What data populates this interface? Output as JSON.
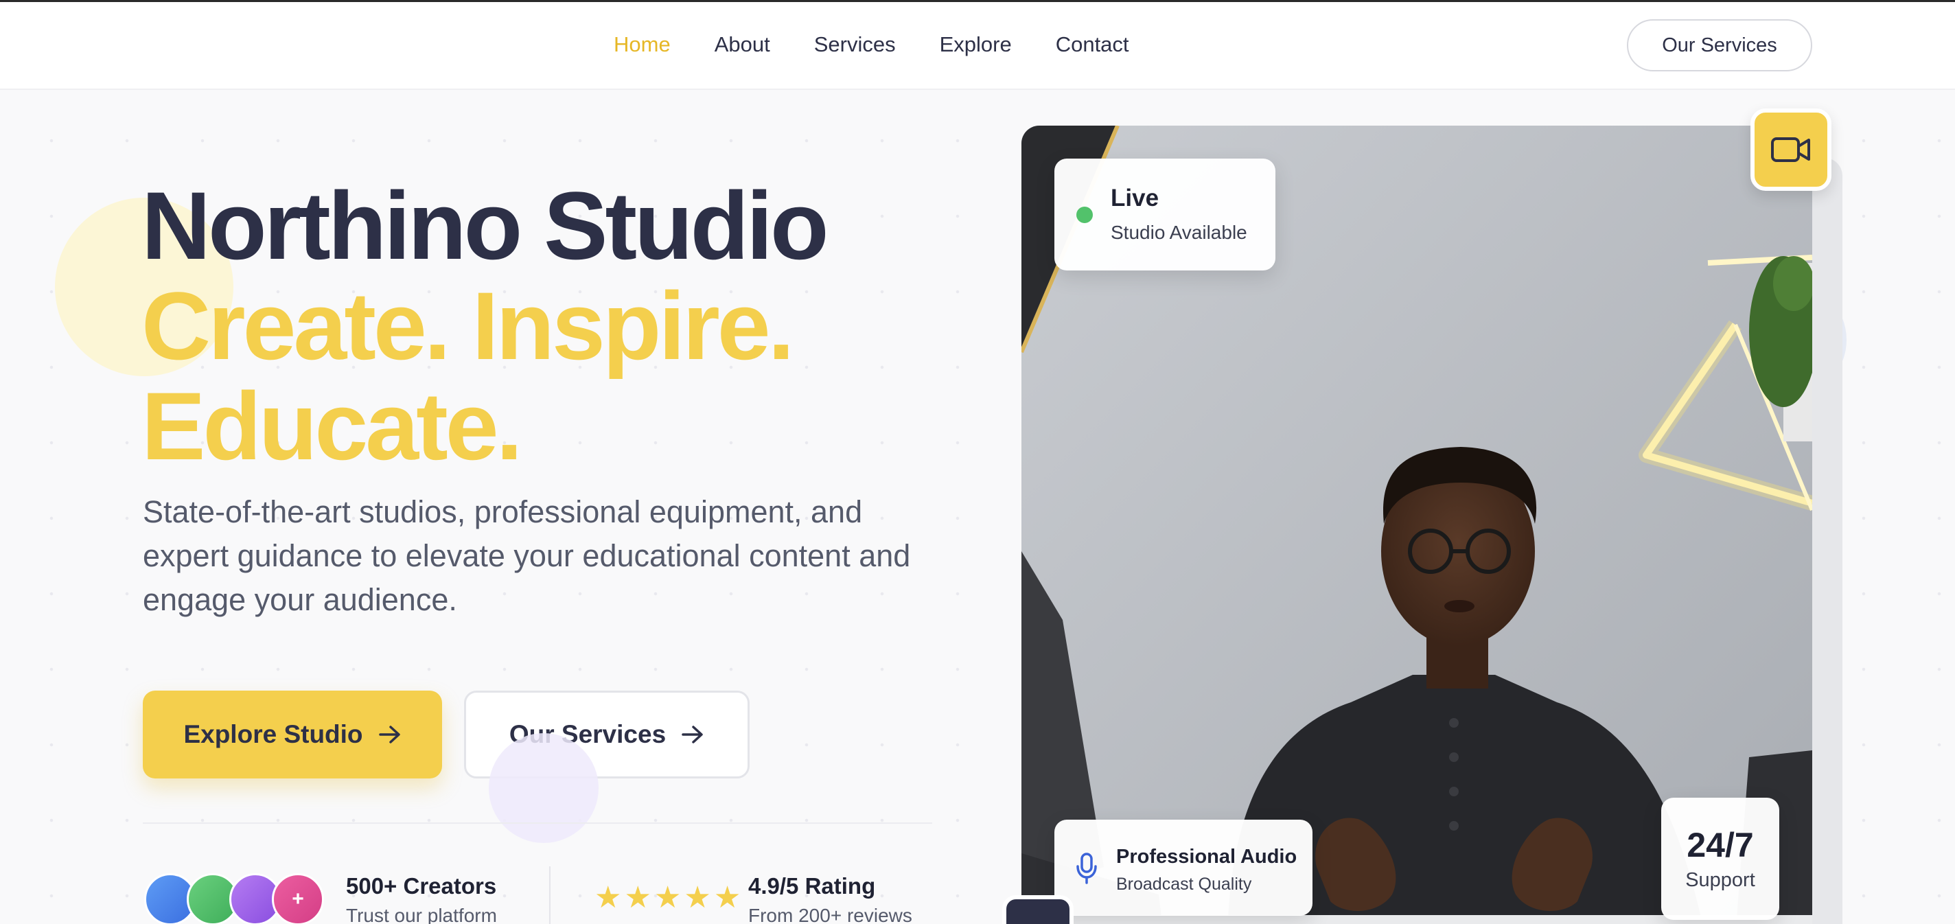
{
  "nav": {
    "items": [
      "Home",
      "About",
      "Services",
      "Explore",
      "Contact"
    ],
    "active": "Home",
    "cta_label": "Our Services"
  },
  "hero": {
    "title_line1": "Northino Studio",
    "title_line2": "Create. Inspire.",
    "title_line3": "Educate.",
    "description": "State-of-the-art studios, professional equipment, and expert guidance to elevate your educational content and engage your audience.",
    "primary_button": "Explore Studio",
    "secondary_button": "Our Services",
    "avatar_more": "+"
  },
  "stats": {
    "creators_title": "500+ Creators",
    "creators_sub": "Trust our platform",
    "rating_title": "4.9/5 Rating",
    "rating_sub": "From 200+ reviews",
    "stars": 5
  },
  "cards": {
    "live_title": "Live",
    "live_sub": "Studio Available",
    "audio_title": "Professional Audio",
    "audio_sub": "Broadcast Quality",
    "support_title": "24/7",
    "support_sub": "Support"
  },
  "colors": {
    "accent": "#f4cf4d",
    "navy": "#2d3047",
    "live": "#52c26b"
  },
  "icons": {
    "header_badge": "video-camera-icon",
    "audio": "microphone-icon",
    "arrow": "arrow-right-icon",
    "star": "star-icon"
  }
}
